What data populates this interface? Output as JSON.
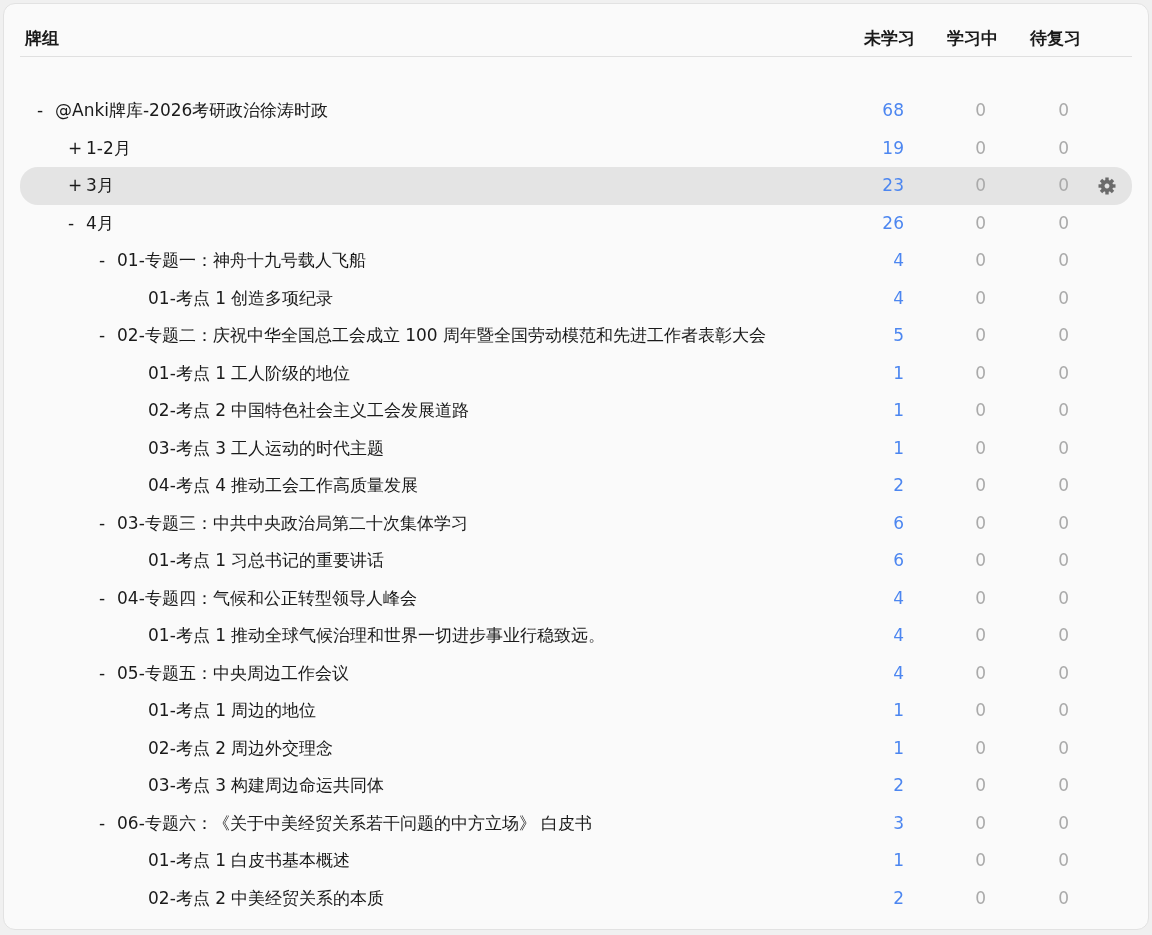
{
  "header": {
    "name": "牌组",
    "new": "未学习",
    "learning": "学习中",
    "review": "待复习"
  },
  "decks": [
    {
      "toggle": "-",
      "name": "@Anki牌库-2026考研政治徐涛时政",
      "new": "68",
      "learning": "0",
      "review": "0",
      "selected": false,
      "children": [
        {
          "toggle": "+",
          "name": "1-2月",
          "new": "19",
          "learning": "0",
          "review": "0",
          "selected": false
        },
        {
          "toggle": "+",
          "name": "3月",
          "new": "23",
          "learning": "0",
          "review": "0",
          "selected": true
        },
        {
          "toggle": "-",
          "name": "4月",
          "new": "26",
          "learning": "0",
          "review": "0",
          "selected": false,
          "children": [
            {
              "toggle": "-",
              "name": "01-专题一：神舟十九号载人飞船",
              "new": "4",
              "learning": "0",
              "review": "0",
              "selected": false,
              "children": [
                {
                  "name": "01-考点 1 创造多项纪录",
                  "new": "4",
                  "learning": "0",
                  "review": "0",
                  "selected": false
                }
              ]
            },
            {
              "toggle": "-",
              "name": "02-专题二：庆祝中华全国总工会成立 100 周年暨全国劳动模范和先进工作者表彰大会",
              "new": "5",
              "learning": "0",
              "review": "0",
              "selected": false,
              "children": [
                {
                  "name": "01-考点 1 工人阶级的地位",
                  "new": "1",
                  "learning": "0",
                  "review": "0",
                  "selected": false
                },
                {
                  "name": "02-考点 2 中国特色社会主义工会发展道路",
                  "new": "1",
                  "learning": "0",
                  "review": "0",
                  "selected": false
                },
                {
                  "name": "03-考点 3 工人运动的时代主题",
                  "new": "1",
                  "learning": "0",
                  "review": "0",
                  "selected": false
                },
                {
                  "name": "04-考点 4 推动工会工作高质量发展",
                  "new": "2",
                  "learning": "0",
                  "review": "0",
                  "selected": false
                }
              ]
            },
            {
              "toggle": "-",
              "name": "03-专题三：中共中央政治局第二十次集体学习",
              "new": "6",
              "learning": "0",
              "review": "0",
              "selected": false,
              "children": [
                {
                  "name": "01-考点 1 习总书记的重要讲话",
                  "new": "6",
                  "learning": "0",
                  "review": "0",
                  "selected": false
                }
              ]
            },
            {
              "toggle": "-",
              "name": "04-专题四：气候和公正转型领导人峰会",
              "new": "4",
              "learning": "0",
              "review": "0",
              "selected": false,
              "children": [
                {
                  "name": "01-考点 1 推动全球气候治理和世界一切进步事业行稳致远。",
                  "new": "4",
                  "learning": "0",
                  "review": "0",
                  "selected": false
                }
              ]
            },
            {
              "toggle": "-",
              "name": "05-专题五：中央周边工作会议",
              "new": "4",
              "learning": "0",
              "review": "0",
              "selected": false,
              "children": [
                {
                  "name": "01-考点 1 周边的地位",
                  "new": "1",
                  "learning": "0",
                  "review": "0",
                  "selected": false
                },
                {
                  "name": "02-考点 2 周边外交理念",
                  "new": "1",
                  "learning": "0",
                  "review": "0",
                  "selected": false
                },
                {
                  "name": "03-考点 3 构建周边命运共同体",
                  "new": "2",
                  "learning": "0",
                  "review": "0",
                  "selected": false
                }
              ]
            },
            {
              "toggle": "-",
              "name": "06-专题六：《关于中美经贸关系若干问题的中方立场》 白皮书",
              "new": "3",
              "learning": "0",
              "review": "0",
              "selected": false,
              "children": [
                {
                  "name": "01-考点 1 白皮书基本概述",
                  "new": "1",
                  "learning": "0",
                  "review": "0",
                  "selected": false
                },
                {
                  "name": "02-考点 2 中美经贸关系的本质",
                  "new": "2",
                  "learning": "0",
                  "review": "0",
                  "selected": false
                }
              ]
            }
          ]
        }
      ]
    }
  ]
}
